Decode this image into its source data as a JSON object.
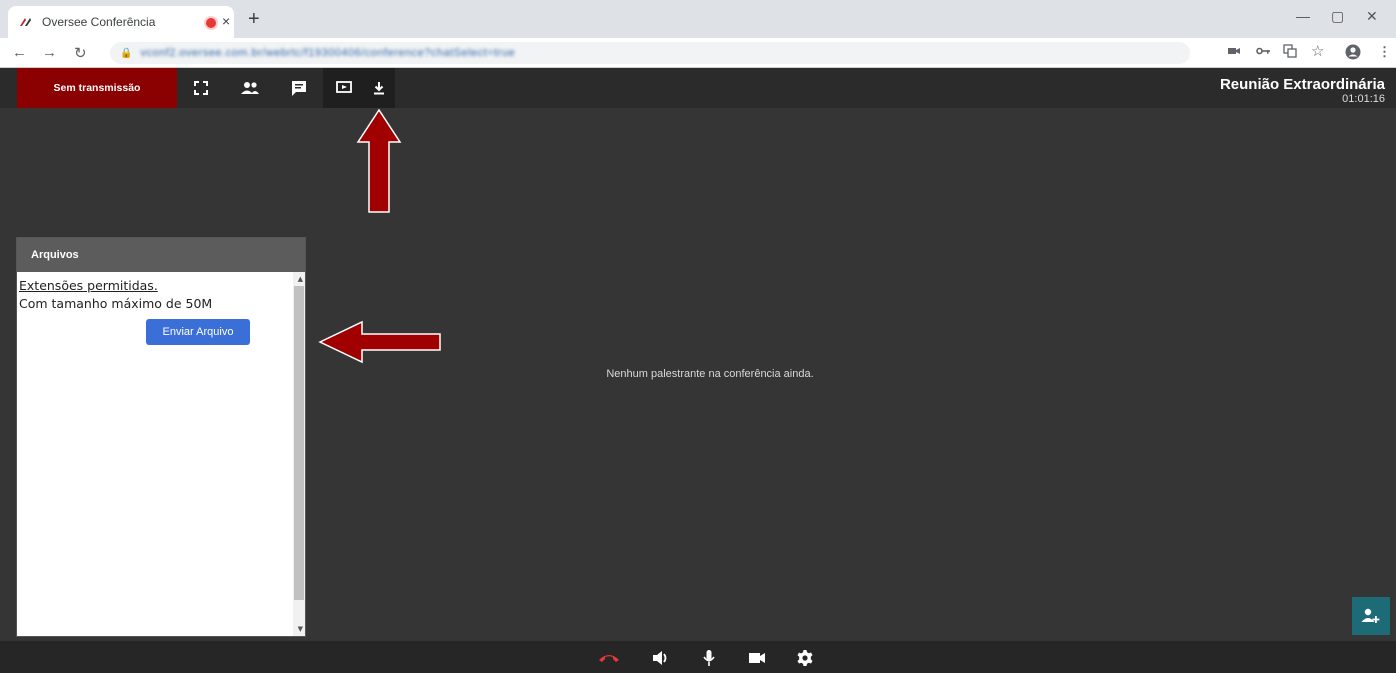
{
  "browser": {
    "tab_title": "Oversee Conferência",
    "tab_close": "×",
    "new_tab": "+",
    "url": "vconf2.oversee.com.br/webrtc/f19300406/conference?chatSelect=true",
    "win_minimize": "—",
    "win_maximize": "▢",
    "win_close": "✕"
  },
  "toolbar": {
    "stream_status": "Sem transmissão",
    "meeting_title": "Reunião Extraordinária",
    "meeting_time": "01:01:16"
  },
  "files_panel": {
    "header": "Arquivos",
    "allowed_extensions": "Extensões permitidas.",
    "max_size": "Com tamanho máximo de 50M",
    "send_button": "Enviar Arquivo"
  },
  "main": {
    "no_speaker_message": "Nenhum palestrante na conferência ainda."
  },
  "annotations": {
    "arrow_color": "#a00000"
  },
  "icons": [
    "fullscreen-icon",
    "participants-icon",
    "chat-icon",
    "screen-share-icon",
    "download-icon",
    "hangup-icon",
    "volume-icon",
    "microphone-icon",
    "camera-icon",
    "settings-icon",
    "add-participant-icon"
  ]
}
